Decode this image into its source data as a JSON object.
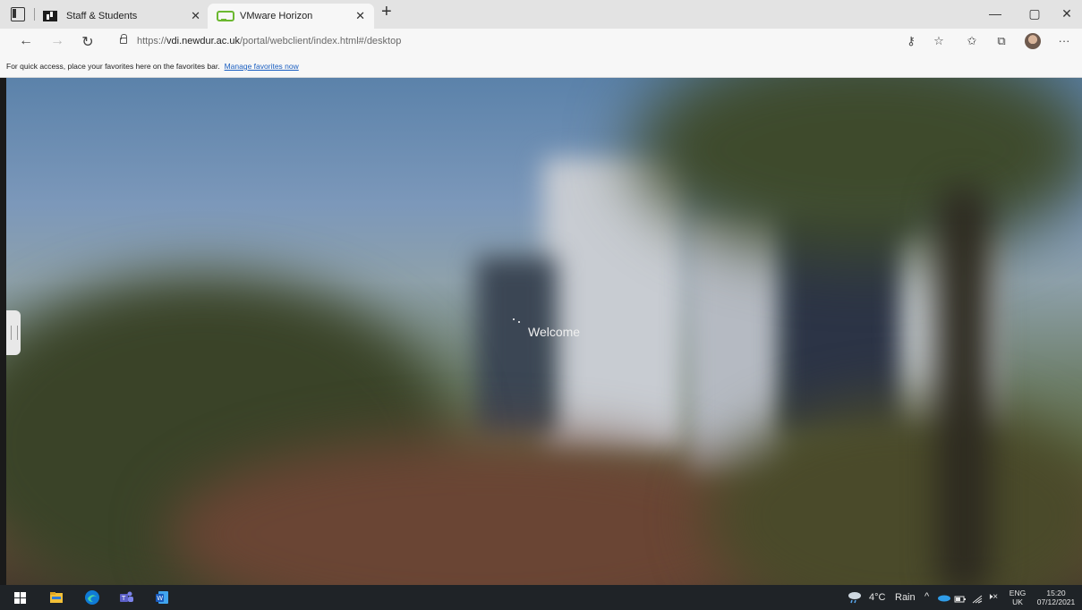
{
  "browser": {
    "tabs": [
      {
        "label": "Staff & Students",
        "active": false
      },
      {
        "label": "VMware Horizon",
        "active": true
      }
    ],
    "tab_close": "✕",
    "new_tab": "+",
    "window_controls": {
      "minimize": "—",
      "maximize": "▢",
      "close": "✕"
    },
    "nav": {
      "back": "←",
      "forward": "→",
      "refresh": "↻"
    },
    "url": {
      "scheme": "https://",
      "host": "vdi.newdur.ac.uk",
      "path": "/portal/webclient/index.html#/desktop"
    },
    "toolbar_icons": [
      "key-icon",
      "read-aloud-icon",
      "favorites-icon",
      "collections-icon",
      "profile-avatar",
      "more-icon"
    ],
    "more_label": "···",
    "favorites_bar": {
      "text": "For quick access, place your favorites here on the favorites bar.",
      "link": "Manage favorites now"
    }
  },
  "remote_desktop": {
    "welcome_text": "Welcome",
    "background": "blurred campus building with trees"
  },
  "taskbar": {
    "pinned": [
      "start-icon",
      "file-explorer-icon",
      "edge-icon",
      "teams-icon",
      "word-icon"
    ],
    "weather": {
      "temp": "4°C",
      "condition": "Rain"
    },
    "tray_up": "^",
    "language": {
      "line1": "ENG",
      "line2": "UK"
    },
    "clock": {
      "time": "15:20",
      "date": "07/12/2021"
    },
    "volume": "🕨×"
  },
  "colors": {
    "accent_link": "#1b5fc1",
    "vmware_green": "#6bb830",
    "edge_blue": "#0f7bd6",
    "taskbar_bg": "#1f2327"
  }
}
